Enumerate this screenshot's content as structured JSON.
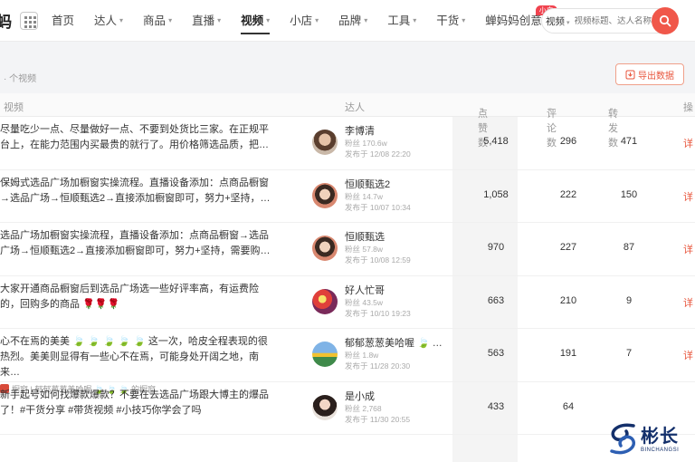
{
  "header": {
    "logo_char": "蚂",
    "nav": [
      {
        "label": "首页",
        "chevron": false
      },
      {
        "label": "达人",
        "chevron": true
      },
      {
        "label": "商品",
        "chevron": true
      },
      {
        "label": "直播",
        "chevron": true
      },
      {
        "label": "视频",
        "chevron": true,
        "active": true
      },
      {
        "label": "小店",
        "chevron": true
      },
      {
        "label": "品牌",
        "chevron": true
      },
      {
        "label": "工具",
        "chevron": true
      },
      {
        "label": "干货",
        "chevron": true
      },
      {
        "label": "蝉妈妈创意",
        "chevron": false,
        "badge": "小白"
      }
    ],
    "search": {
      "type_label": "视频",
      "placeholder": "视频标题、达人名称"
    }
  },
  "toolbar": {
    "count_text": "· 个视频",
    "export_label": "导出数据"
  },
  "table": {
    "headers": {
      "video": "视频",
      "talent": "达人",
      "likes": "点赞数",
      "comments": "评论数",
      "shares": "转发数",
      "actions": "操"
    },
    "rows": [
      {
        "desc": "尽量吃少一点、尽量做好一点、不要到处货比三家。在正规平台上，在能力范围内买最贵的就行了。用价格筛选品质，把…",
        "tag": "",
        "name": "李博清",
        "fans": "粉丝 170.6w",
        "published": "发布于 12/08 22:20",
        "likes": "5,418",
        "comments": "296",
        "shares": "471",
        "detail": "详"
      },
      {
        "desc": "保姆式选品广场加橱窗实操流程。直播设备添加：点商品橱窗→选品广场→恒顺甄选2→直接添加橱窗即可，努力+坚持，…",
        "tag": "",
        "name": "恒顺甄选2",
        "fans": "粉丝 14.7w",
        "published": "发布于 10/07 10:34",
        "likes": "1,058",
        "comments": "222",
        "shares": "150",
        "detail": "详"
      },
      {
        "desc": "选品广场加橱窗实操流程，直播设备添加：点商品橱窗→选品广场→恒顺甄选2→直接添加橱窗即可，努力+坚持，需要购…",
        "tag": "",
        "name": "恒顺甄选",
        "fans": "粉丝 57.8w",
        "published": "发布于 10/08 12:59",
        "likes": "970",
        "comments": "227",
        "shares": "87",
        "detail": "详"
      },
      {
        "desc": "大家开通商品橱窗后到选品广场选一些好评率高，有运费险的，回购多的商品 🌹🌹🌹",
        "tag": "",
        "name": "好人忙哥",
        "fans": "粉丝 43.5w",
        "published": "发布于 10/10 19:23",
        "likes": "663",
        "comments": "210",
        "shares": "9",
        "detail": "详"
      },
      {
        "desc": "心不在焉的美美 🍃 🍃 🍃 🍃 🍃 这一次，哈皮全程表现的很热烈。美美则显得有一些心不在焉，可能身处开阔之地，南来…",
        "tag": "橱窗 | 郁郁葱葱美哈喔 🍃 🍃 🍃 的橱窗",
        "name": "郁郁葱葱美哈喔 🍃 …",
        "fans": "粉丝 1.8w",
        "published": "发布于 11/28 20:30",
        "likes": "563",
        "comments": "191",
        "shares": "7",
        "detail": "详"
      },
      {
        "desc": "新手起号如何找爆款爆款？不要在去选品广场跟大博主的爆品了！#干货分享 #带货视频 #小技巧你学会了吗",
        "tag": "",
        "name": "是小成",
        "fans": "粉丝 2,768",
        "published": "发布于 11/30 20:55",
        "likes": "433",
        "comments": "64",
        "shares": "",
        "detail": ""
      }
    ]
  },
  "watermark": {
    "text": "彬长",
    "sub": "BINCHANGSI"
  },
  "colors": {
    "accent": "#f0574a",
    "link": "#e8553c",
    "watermark": "#14306b"
  }
}
